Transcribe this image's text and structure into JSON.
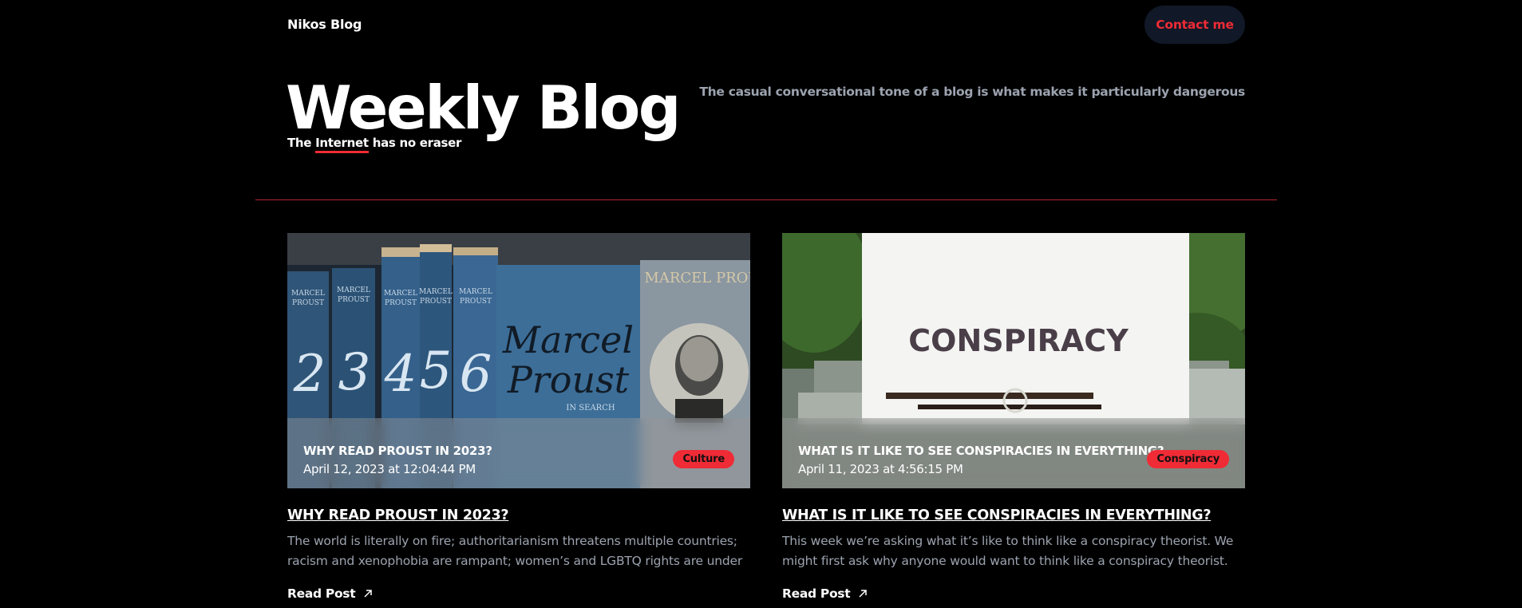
{
  "header": {
    "brand": "Nikos Blog",
    "contact_label": "Contact me"
  },
  "hero": {
    "title": "Weekly Blog",
    "subtitle_before": "The",
    "subtitle_highlight": "Internet",
    "subtitle_after": "has no eraser",
    "tagline": "The casual conversational tone of a blog is what makes it particularly dangerous"
  },
  "posts": [
    {
      "overlay_title": "WHY READ PROUST IN 2023?",
      "date": "April 12, 2023 at 12:04:44 PM",
      "category": "Culture",
      "title": "WHY READ PROUST IN 2023?",
      "excerpt": "The world is literally on fire; authoritarianism threatens multiple countries; racism and xenophobia are rampant; women’s and LGBTQ rights are under threat—why read Proust now?",
      "read_label": "Read Post",
      "image_books": [
        {
          "vol": "2"
        },
        {
          "vol": "3"
        },
        {
          "vol": "4"
        },
        {
          "vol": "5"
        },
        {
          "vol": "6"
        }
      ],
      "image_cover_text": "MARCEL PROUST",
      "image_spine_text": "IN SEARCH OF LOST TIME"
    },
    {
      "overlay_title": "WHAT IS IT LIKE TO SEE CONSPIRACIES IN EVERYTHING?",
      "date": "April 11, 2023 at 4:56:15 PM",
      "category": "Conspiracy",
      "title": "WHAT IS IT LIKE TO SEE CONSPIRACIES IN EVERYTHING?",
      "excerpt": "This week we’re asking what it’s like to think like a conspiracy theorist. We might first ask why anyone would want to think like a conspiracy theorist.",
      "read_label": "Read Post",
      "image_paper_text": "CONSPIRACY"
    }
  ],
  "icons": {
    "arrow": "arrow-up-right-icon"
  },
  "colors": {
    "accent": "#ef2b36",
    "background": "#000000",
    "muted_text": "#9ca3af",
    "button_bg": "#111827"
  }
}
